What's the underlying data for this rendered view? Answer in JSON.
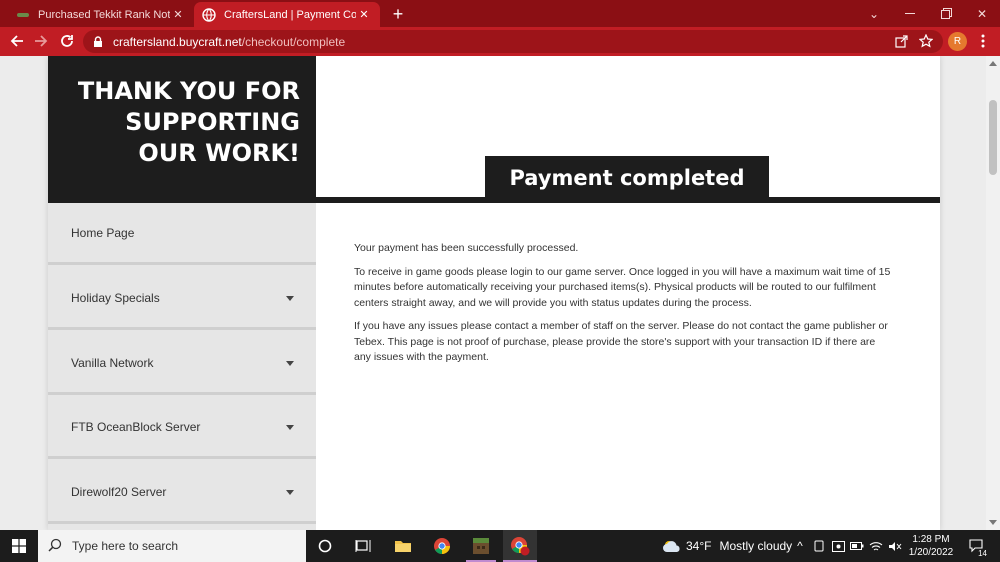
{
  "browser": {
    "tabs": [
      {
        "title": "Purchased Tekkit Rank Not Recei",
        "active": false
      },
      {
        "title": "CraftersLand | Payment Complete",
        "active": true
      }
    ],
    "url_host": "craftersland.buycraft.net",
    "url_path": "/checkout/complete",
    "profile_initial": "R"
  },
  "page": {
    "hero_title": "THANK YOU FOR SUPPORTING OUR WORK!",
    "payment_heading": "Payment completed",
    "sidebar": [
      {
        "label": "Home Page",
        "has_dropdown": false
      },
      {
        "label": "Holiday Specials",
        "has_dropdown": true
      },
      {
        "label": "Vanilla Network",
        "has_dropdown": true
      },
      {
        "label": "FTB OceanBlock Server",
        "has_dropdown": true
      },
      {
        "label": "Direwolf20 Server",
        "has_dropdown": true
      }
    ],
    "paragraphs": [
      "Your payment has been successfully processed.",
      "To receive in game goods please login to our game server. Once logged in you will have a maximum wait time of 15 minutes before automatically receiving your purchased items(s). Physical products will be routed to our fulfilment centers straight away, and we will provide you with status updates during the process.",
      "If you have any issues please contact a member of staff on the server. Please do not contact the game publisher or Tebex. This page is not proof of purchase, please provide the store's support with your transaction ID if there are any issues with the payment."
    ]
  },
  "taskbar": {
    "search_placeholder": "Type here to search",
    "weather_temp": "34°F",
    "weather_desc": "Mostly cloudy",
    "time": "1:28 PM",
    "date": "1/20/2022",
    "notification_count": "14"
  },
  "colors": {
    "tabstrip": "#8b0f14",
    "toolbar": "#c11d24",
    "hero_dark": "#1d1d1d",
    "sidebar_bg": "#e6e6e6"
  }
}
